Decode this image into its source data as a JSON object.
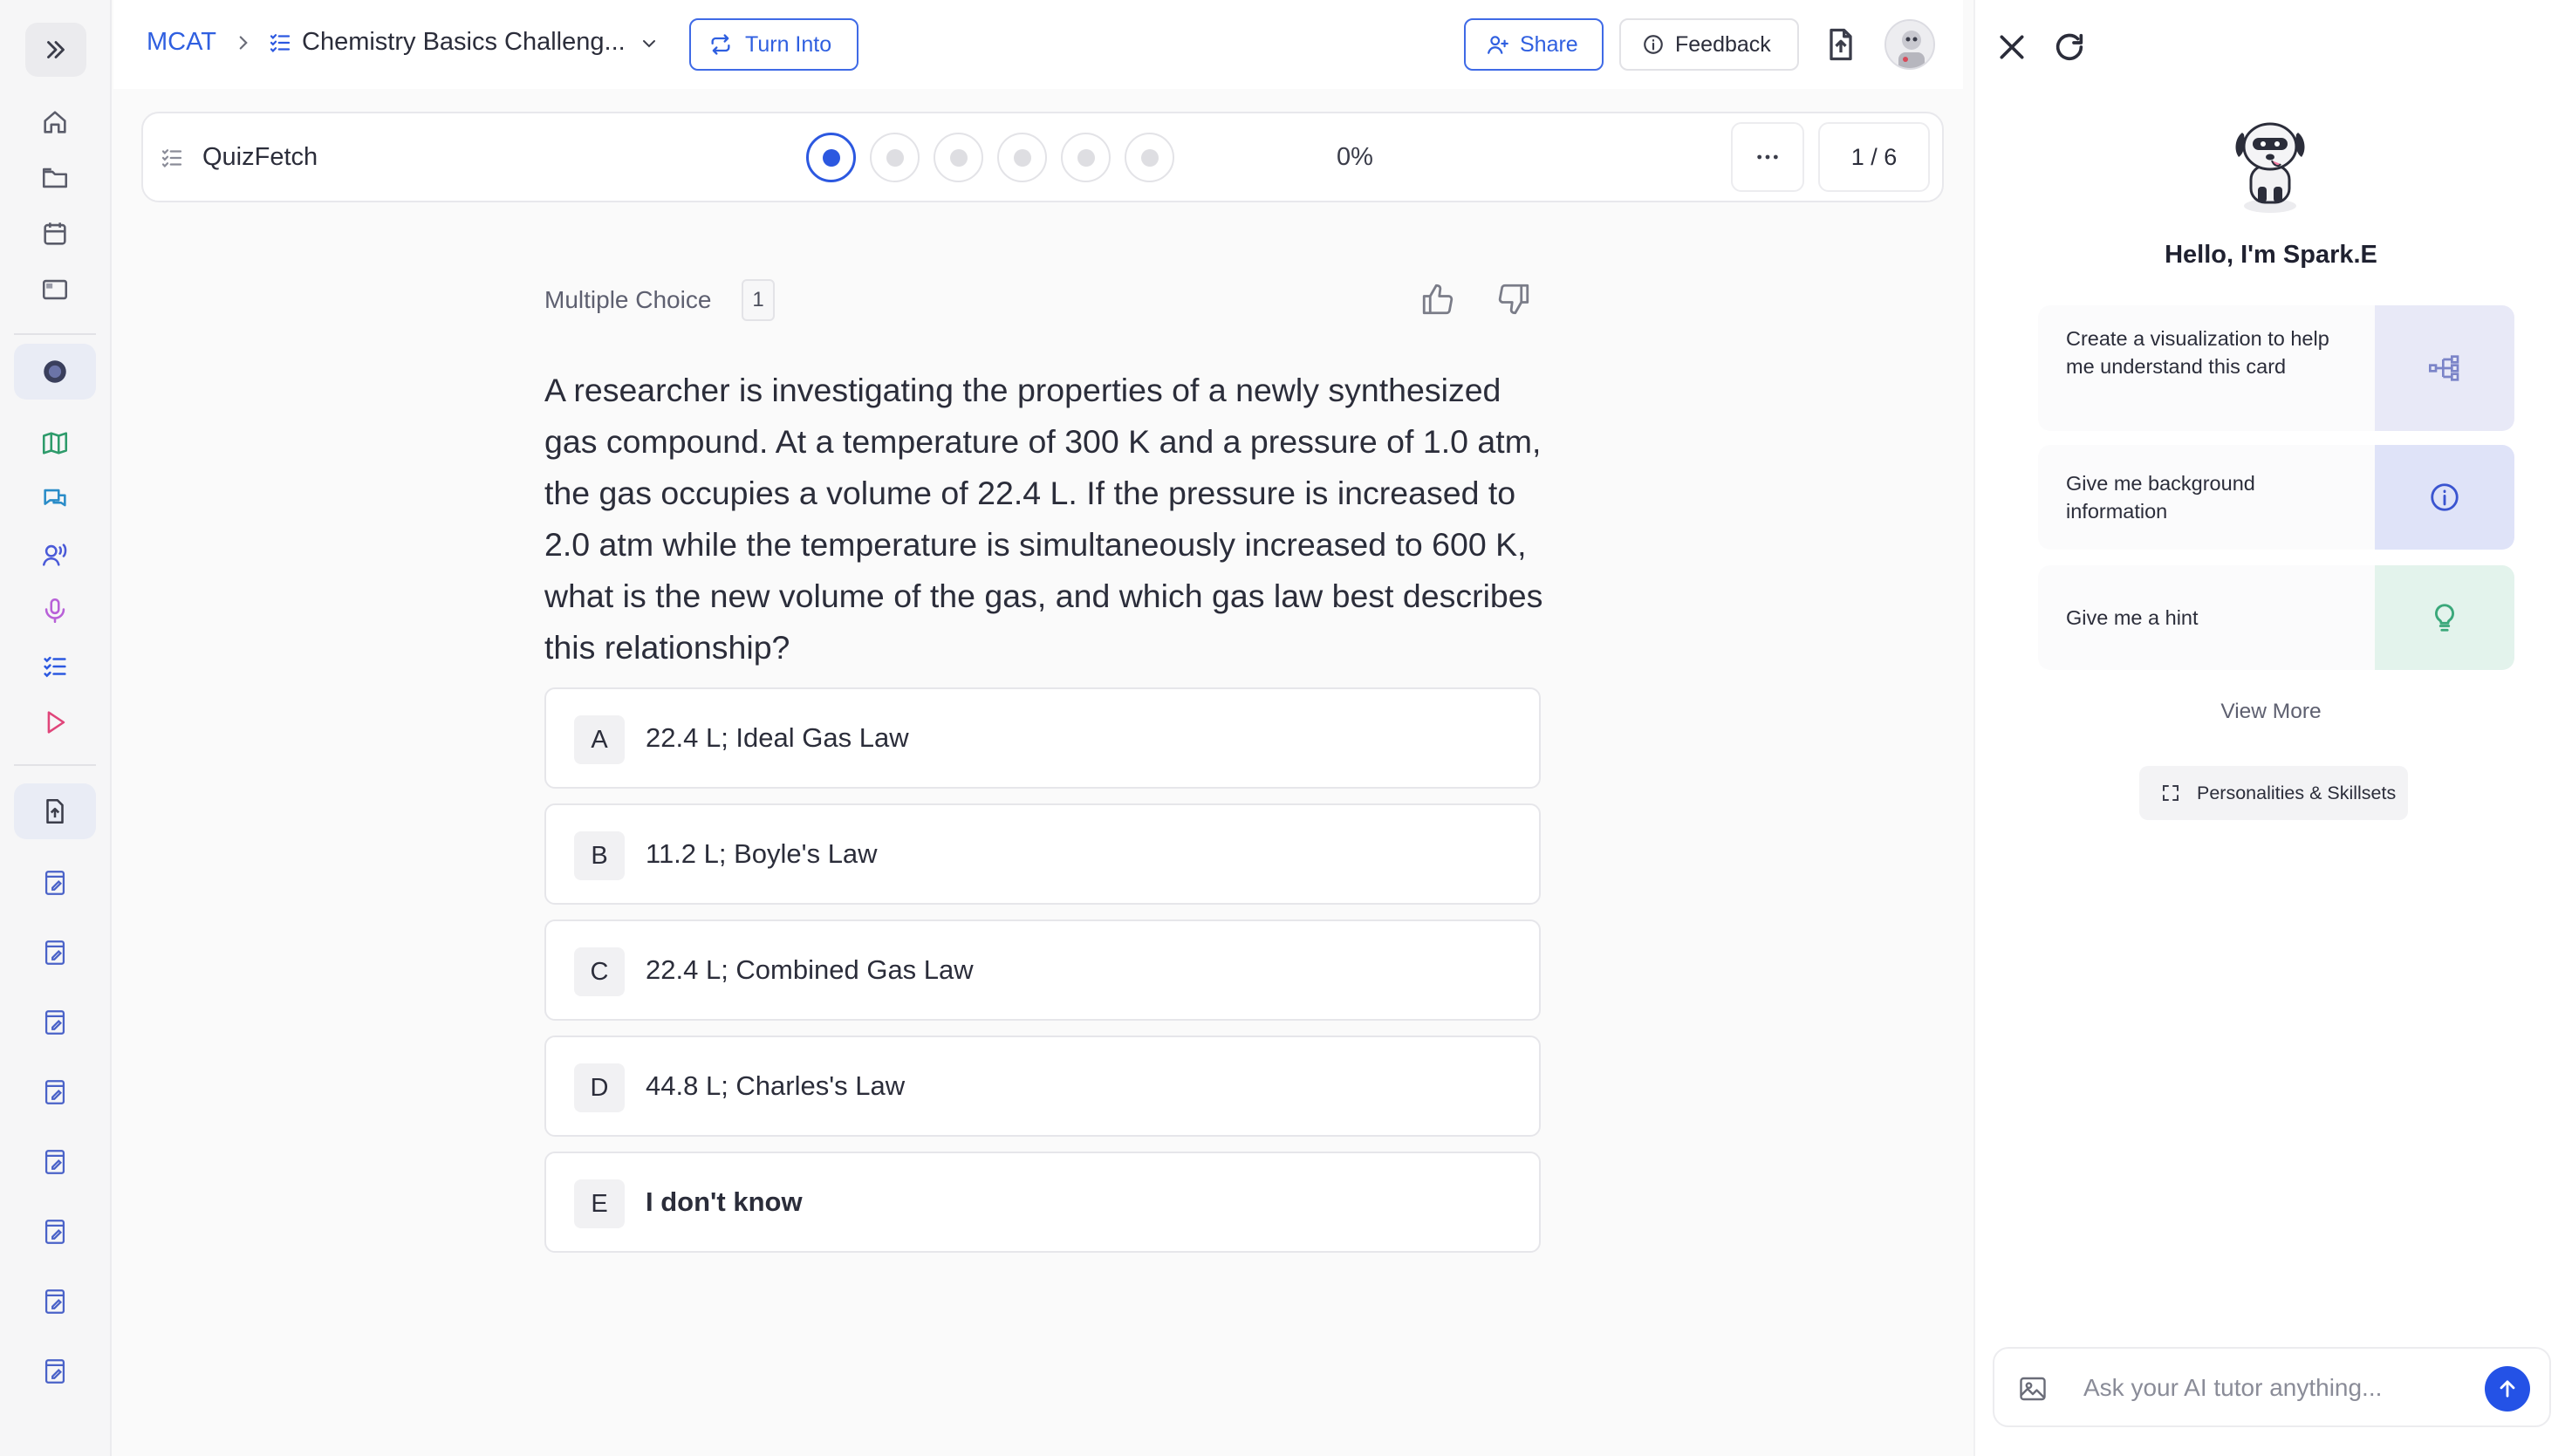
{
  "breadcrumb": {
    "root": "MCAT",
    "title": "Chemistry Basics Challeng...",
    "turn_into_label": "Turn Into"
  },
  "header": {
    "share_label": "Share",
    "feedback_label": "Feedback"
  },
  "quiz": {
    "name": "QuizFetch",
    "progress_percent": "0%",
    "progress_value": 0,
    "counter": "1 / 6",
    "total_questions": 6,
    "current_question": 1
  },
  "question": {
    "type_label": "Multiple Choice",
    "number": "1",
    "text": "A researcher is investigating the properties of a newly synthesized gas compound. At a temperature of 300 K and a pressure of 1.0 atm, the gas occupies a volume of 22.4 L. If the pressure is increased to 2.0 atm while the temperature is simultaneously increased to 600 K, what is the new volume of the gas, and which gas law best describes this relationship?",
    "options": [
      {
        "letter": "A",
        "text": "22.4 L; Ideal Gas Law"
      },
      {
        "letter": "B",
        "text": "11.2 L; Boyle's Law"
      },
      {
        "letter": "C",
        "text": "22.4 L; Combined Gas Law"
      },
      {
        "letter": "D",
        "text": "44.8 L; Charles's Law"
      },
      {
        "letter": "E",
        "text": "I don't know"
      }
    ]
  },
  "assistant": {
    "greeting": "Hello, I'm Spark.E",
    "suggestions": [
      {
        "text": "Create a visualization to help me understand this card",
        "icon": "diagram-icon",
        "color": "#e8e9f7"
      },
      {
        "text": "Give me background information",
        "icon": "info-icon",
        "color": "#dfe3f8"
      },
      {
        "text": "Give me a hint",
        "icon": "lightbulb-icon",
        "color": "#e3f3ec"
      }
    ],
    "view_more_label": "View More",
    "personalities_label": "Personalities & Skillsets",
    "input_placeholder": "Ask your AI tutor anything..."
  },
  "colors": {
    "accent": "#2c58e0",
    "send_button": "#2452e6"
  }
}
